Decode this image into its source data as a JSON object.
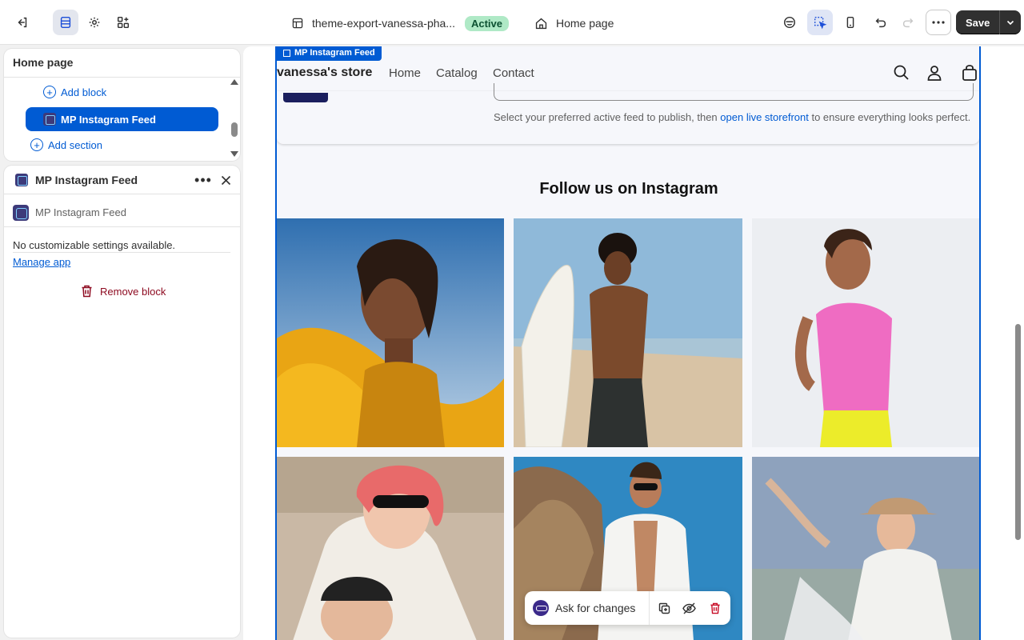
{
  "topbar": {
    "theme_name": "theme-export-vanessa-pha...",
    "theme_status": "Active",
    "page_name": "Home page",
    "save_label": "Save"
  },
  "sidebar": {
    "title": "Home page",
    "add_block": "Add block",
    "selected_block": "MP Instagram Feed",
    "add_section": "Add section"
  },
  "block_panel": {
    "title": "MP Instagram Feed",
    "app_name": "MP Instagram Feed",
    "no_settings": "No customizable settings available.",
    "manage_link": "Manage app",
    "remove_label": "Remove block"
  },
  "preview": {
    "section_tag": "MP Instagram Feed",
    "store_name": "vanessa's store",
    "nav": [
      "Home",
      "Catalog",
      "Contact"
    ],
    "help_text_before": "Select your preferred active feed to publish, then ",
    "help_link": "open live storefront",
    "help_text_after": " to ensure everything looks perfect.",
    "feed_title": "Follow us on Instagram"
  },
  "floatbar": {
    "label": "Ask for changes"
  },
  "colors": {
    "accent": "#005bd3",
    "active_badge_bg": "#afe9c6",
    "danger": "#8e0b21"
  }
}
